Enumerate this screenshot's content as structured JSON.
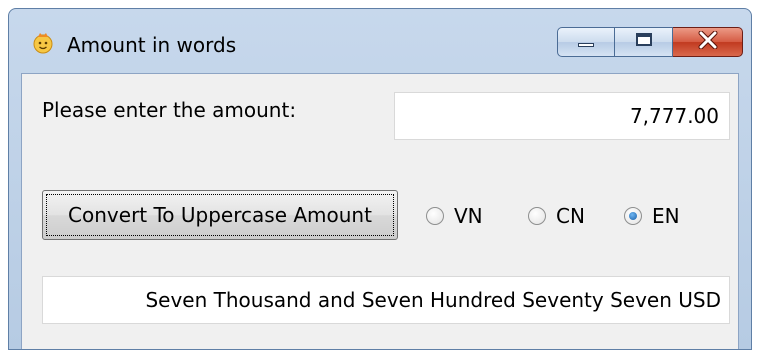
{
  "window": {
    "title": "Amount in words",
    "icon": "face-icon",
    "controls": [
      "minimize-icon",
      "maximize-icon",
      "close-icon"
    ]
  },
  "form": {
    "amount_label": "Please enter the amount:",
    "amount_value": "7,777.00",
    "convert_button_label": "Convert To Uppercase Amount",
    "language_options": [
      {
        "label": "VN",
        "selected": false
      },
      {
        "label": "CN",
        "selected": false
      },
      {
        "label": "EN",
        "selected": true
      }
    ],
    "result_text": "Seven Thousand and Seven Hundred Seventy Seven USD"
  },
  "colors": {
    "frame": "#b6cbe3",
    "client": "#f0f0f0",
    "close_button": "#c13a20",
    "radio_selected": "#1a5fa8"
  }
}
